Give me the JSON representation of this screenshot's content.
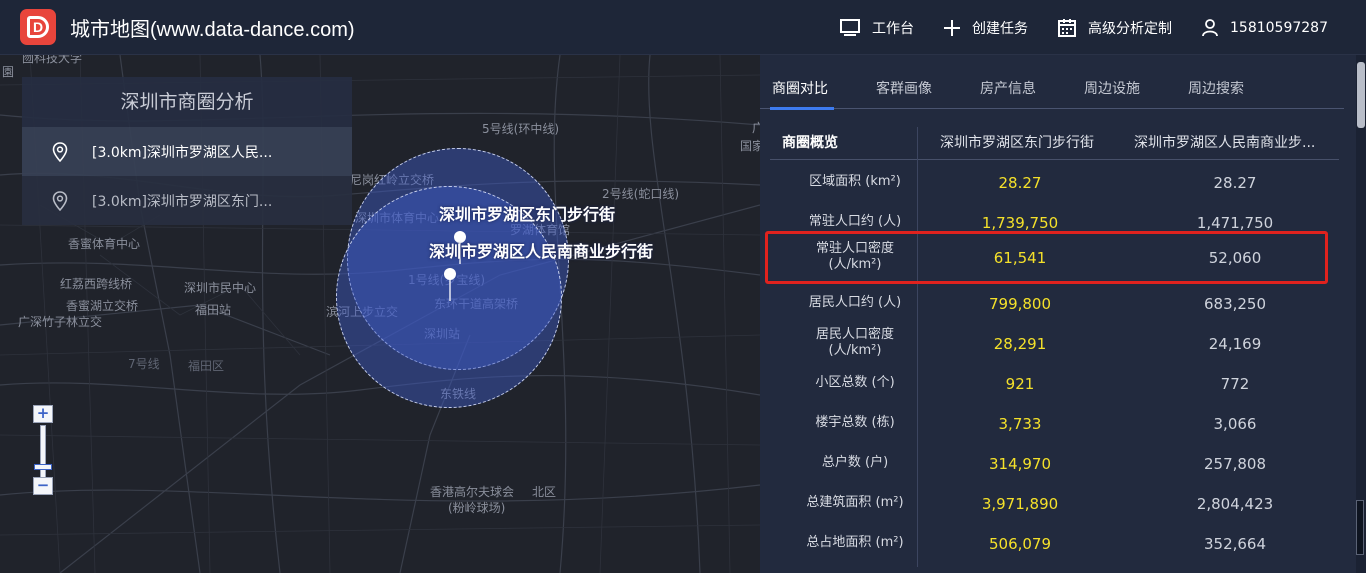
{
  "header": {
    "title": "城市地图(www.data-dance.com)",
    "logo_letter": "D",
    "nav": [
      {
        "icon": "monitor-icon",
        "label": "工作台"
      },
      {
        "icon": "plus-icon",
        "label": "创建任务"
      },
      {
        "icon": "calendar-icon",
        "label": "高级分析定制"
      },
      {
        "icon": "user-icon",
        "label": "15810597287"
      }
    ]
  },
  "sidebar": {
    "title": "深圳市商圈分析",
    "items": [
      {
        "label": "[3.0km]深圳市罗湖区人民...",
        "active": true
      },
      {
        "label": "[3.0km]深圳市罗湖区东门...",
        "active": false
      }
    ]
  },
  "map": {
    "markers": [
      {
        "label": "深圳市罗湖区东门步行街"
      },
      {
        "label": "深圳市罗湖区人民南商业步行街"
      }
    ],
    "labels": [
      "囫科技大学",
      "園",
      "5号线(环中线)",
      "深圳市体育中心",
      "罗湖体育馆",
      "尼岗红岭立交桥",
      "2号线(蛇口线)",
      "香蜜体育中心",
      "红荔西跨线桥",
      "深圳市民中心",
      "香蜜湖立交桥",
      "福田站",
      "广深竹子林立交",
      "滨河上步立交",
      "东环干道高架桥",
      "深圳站",
      "7号线",
      "福田区",
      "东铁线",
      "香港高尔夫球会",
      "北区",
      "(粉岭球场)",
      "1号线(罗宝线)",
      "广",
      "国家"
    ],
    "zoom": {
      "plus": "+",
      "minus": "−"
    }
  },
  "tabs": [
    "商圈对比",
    "客群画像",
    "房产信息",
    "周边设施",
    "周边搜索"
  ],
  "table": {
    "headers": [
      "商圈概览",
      "深圳市罗湖区东门步行街",
      "深圳市罗湖区人民南商业步..."
    ],
    "rows": [
      {
        "label": "区域面积 (km²)",
        "v1": "28.27",
        "v2": "28.27"
      },
      {
        "label": "常驻人口约 (人)",
        "v1": "1,739,750",
        "v2": "1,471,750"
      },
      {
        "label": "常驻人口密度\n(人/km²)",
        "v1": "61,541",
        "v2": "52,060",
        "highlight": true
      },
      {
        "label": "居民人口约 (人)",
        "v1": "799,800",
        "v2": "683,250"
      },
      {
        "label": "居民人口密度\n(人/km²)",
        "v1": "28,291",
        "v2": "24,169"
      },
      {
        "label": "小区总数 (个)",
        "v1": "921",
        "v2": "772"
      },
      {
        "label": "楼宇总数 (栋)",
        "v1": "3,733",
        "v2": "3,066"
      },
      {
        "label": "总户数 (户)",
        "v1": "314,970",
        "v2": "257,808"
      },
      {
        "label": "总建筑面积 (m²)",
        "v1": "3,971,890",
        "v2": "2,804,423"
      },
      {
        "label": "总占地面积 (m²)",
        "v1": "506,079",
        "v2": "352,664"
      }
    ]
  },
  "colors": {
    "accent": "#3d7bf0",
    "value_highlight": "#f5e12a",
    "highlight_box": "#e0221e",
    "logo": "#e8453c",
    "circle_fill": "#3f5ac8"
  }
}
